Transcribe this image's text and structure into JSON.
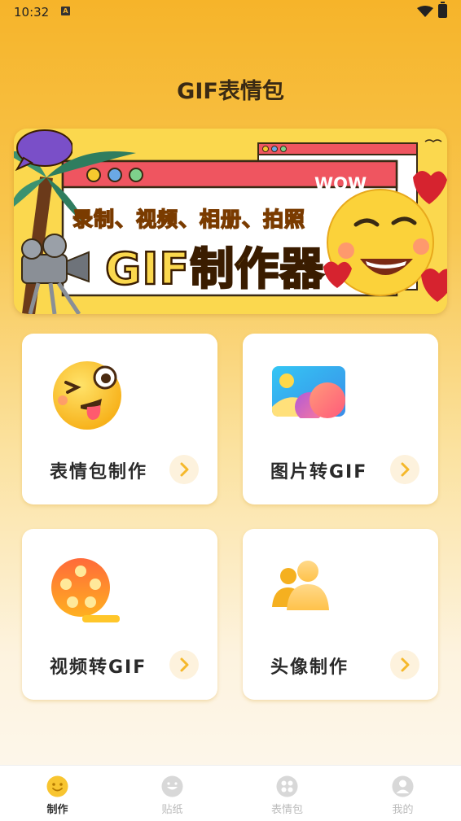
{
  "status": {
    "time": "10:32",
    "indicator": "A"
  },
  "header": {
    "title": "GIF表情包"
  },
  "banner": {
    "line1": "录制、视频、相册、拍照",
    "line2": "GIF制作器",
    "bubble": "WOW"
  },
  "cards": [
    {
      "label": "表情包制作",
      "icon": "tongue-emoji-icon"
    },
    {
      "label": "图片转GIF",
      "icon": "picture-icon"
    },
    {
      "label": "视频转GIF",
      "icon": "film-reel-icon"
    },
    {
      "label": "头像制作",
      "icon": "users-icon"
    }
  ],
  "nav": [
    {
      "label": "制作",
      "active": true
    },
    {
      "label": "贴纸",
      "active": false
    },
    {
      "label": "表情包",
      "active": false
    },
    {
      "label": "我的",
      "active": false
    }
  ],
  "colors": {
    "accent": "#f6b42a",
    "active_icon": "#f8c530",
    "inactive_icon": "#d8d8d8"
  }
}
